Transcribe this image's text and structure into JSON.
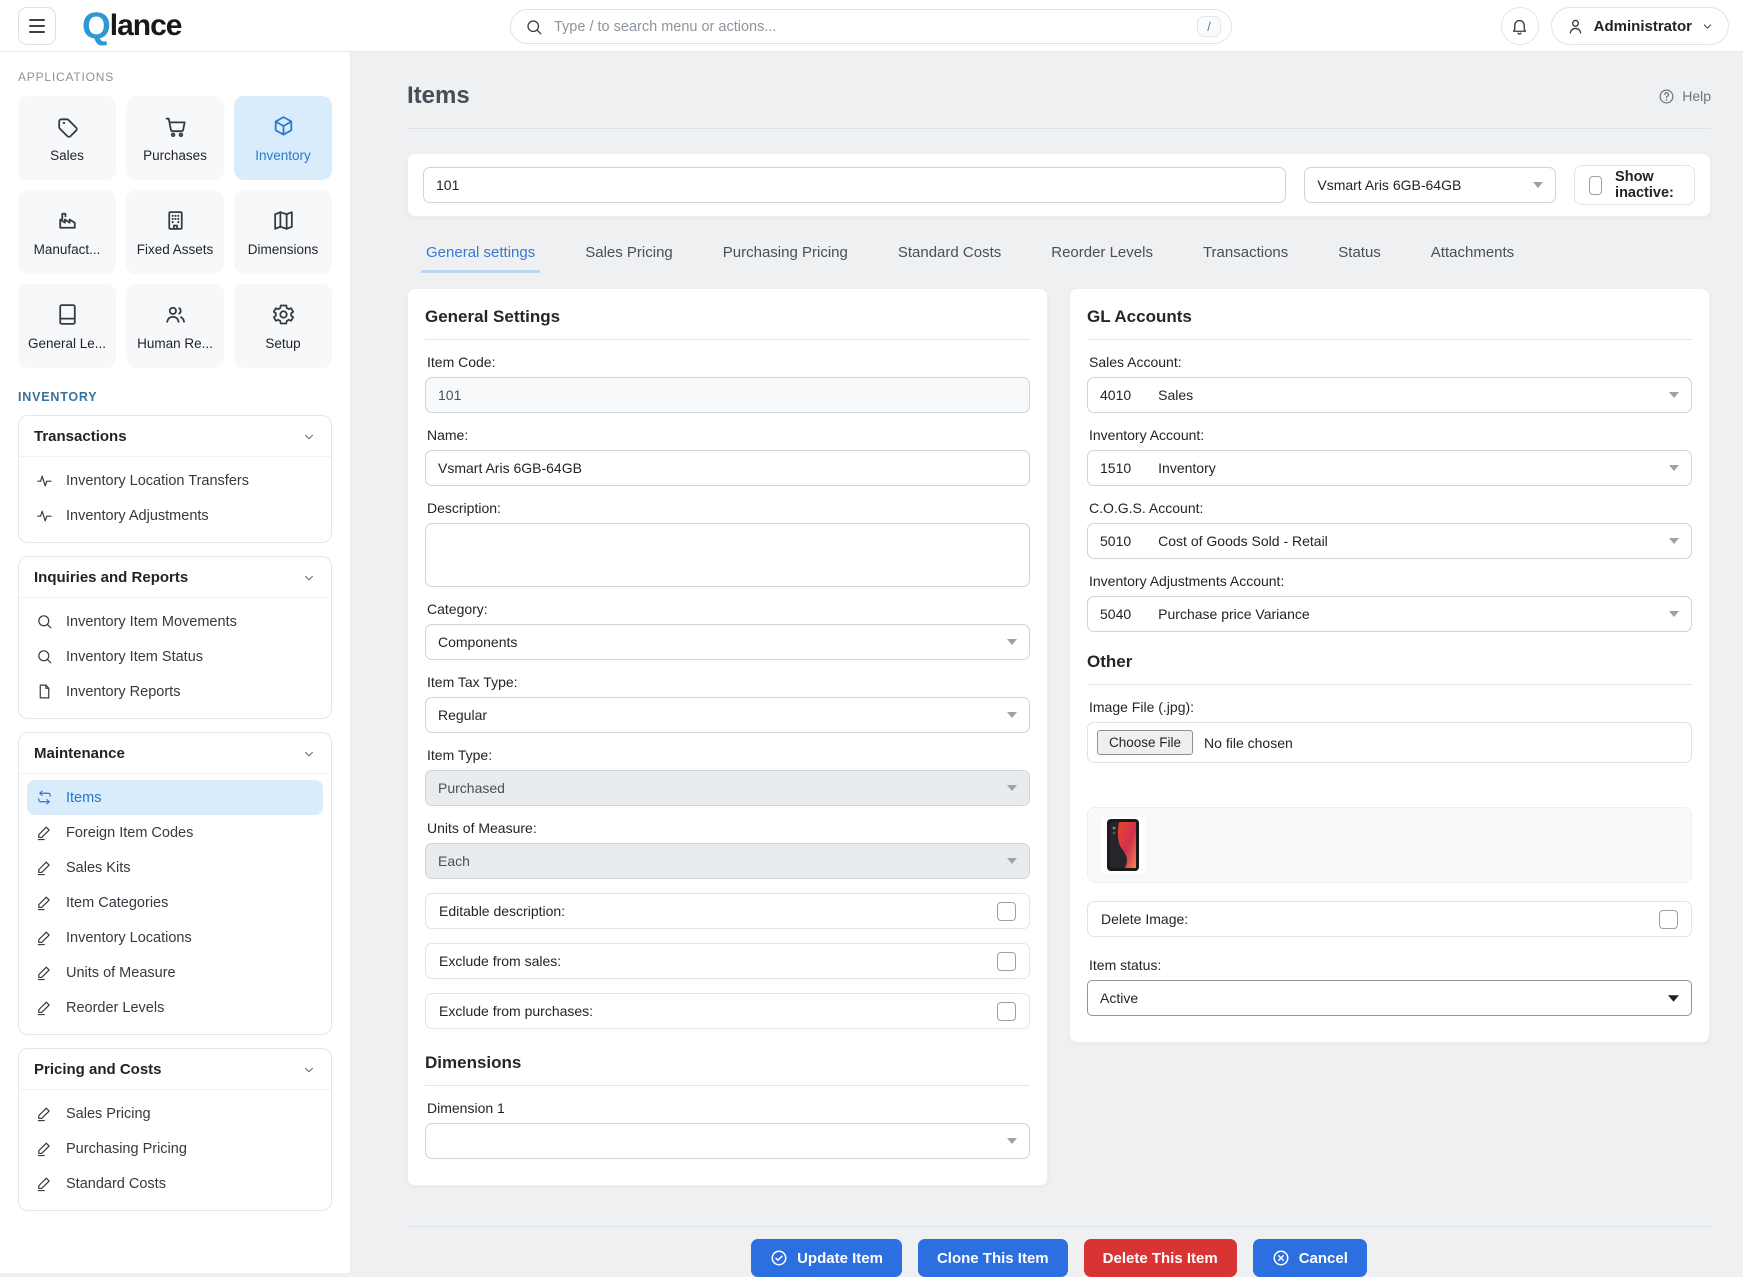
{
  "colors": {
    "accent_blue": "#2C6FE0",
    "danger_red": "#D93434",
    "active_item_bg": "#D9ECFC",
    "link_blue": "#2779C9",
    "brand_blue": "#2F97D4"
  },
  "topbar": {
    "logo_q": "Q",
    "logo_rest": "lance",
    "search_placeholder": "Type / to search menu or actions...",
    "search_shortcut": "/",
    "user_name": "Administrator"
  },
  "sidebar": {
    "applications_label": "APPLICATIONS",
    "apps": [
      {
        "label": "Sales",
        "icon": "tag-icon"
      },
      {
        "label": "Purchases",
        "icon": "cart-icon"
      },
      {
        "label": "Inventory",
        "icon": "cube-icon",
        "active": true
      },
      {
        "label": "Manufact...",
        "icon": "factory-icon"
      },
      {
        "label": "Fixed Assets",
        "icon": "building-icon"
      },
      {
        "label": "Dimensions",
        "icon": "map-icon"
      },
      {
        "label": "General Le...",
        "icon": "book-icon"
      },
      {
        "label": "Human Re...",
        "icon": "people-icon"
      },
      {
        "label": "Setup",
        "icon": "gear-icon"
      }
    ],
    "section_label": "INVENTORY",
    "groups": [
      {
        "title": "Transactions",
        "items": [
          {
            "label": "Inventory Location Transfers",
            "icon": "activity-icon"
          },
          {
            "label": "Inventory Adjustments",
            "icon": "activity-icon"
          }
        ]
      },
      {
        "title": "Inquiries and Reports",
        "items": [
          {
            "label": "Inventory Item Movements",
            "icon": "search-icon"
          },
          {
            "label": "Inventory Item Status",
            "icon": "search-icon"
          },
          {
            "label": "Inventory Reports",
            "icon": "document-icon"
          }
        ]
      },
      {
        "title": "Maintenance",
        "items": [
          {
            "label": "Items",
            "icon": "repeat-icon",
            "active": true
          },
          {
            "label": "Foreign Item Codes",
            "icon": "edit-icon"
          },
          {
            "label": "Sales Kits",
            "icon": "edit-icon"
          },
          {
            "label": "Item Categories",
            "icon": "edit-icon"
          },
          {
            "label": "Inventory Locations",
            "icon": "edit-icon"
          },
          {
            "label": "Units of Measure",
            "icon": "edit-icon"
          },
          {
            "label": "Reorder Levels",
            "icon": "edit-icon"
          }
        ]
      },
      {
        "title": "Pricing and Costs",
        "items": [
          {
            "label": "Sales Pricing",
            "icon": "edit-icon"
          },
          {
            "label": "Purchasing Pricing",
            "icon": "edit-icon"
          },
          {
            "label": "Standard Costs",
            "icon": "edit-icon"
          }
        ]
      }
    ]
  },
  "page": {
    "title": "Items",
    "help_label": "Help",
    "filter": {
      "item_code_value": "101",
      "item_select_value": "Vsmart Aris 6GB-64GB",
      "show_inactive_label": "Show inactive:"
    },
    "tabs": [
      {
        "label": "General settings",
        "active": true
      },
      {
        "label": "Sales Pricing"
      },
      {
        "label": "Purchasing Pricing"
      },
      {
        "label": "Standard Costs"
      },
      {
        "label": "Reorder Levels"
      },
      {
        "label": "Transactions"
      },
      {
        "label": "Status"
      },
      {
        "label": "Attachments"
      }
    ]
  },
  "general": {
    "heading": "General Settings",
    "item_code_label": "Item Code:",
    "item_code_value": "101",
    "name_label": "Name:",
    "name_value": "Vsmart Aris 6GB-64GB",
    "description_label": "Description:",
    "description_value": "",
    "category_label": "Category:",
    "category_value": "Components",
    "item_tax_type_label": "Item Tax Type:",
    "item_tax_type_value": "Regular",
    "item_type_label": "Item Type:",
    "item_type_value": "Purchased",
    "units_label": "Units of Measure:",
    "units_value": "Each",
    "checks": [
      {
        "label": "Editable description:",
        "checked": false
      },
      {
        "label": "Exclude from sales:",
        "checked": false
      },
      {
        "label": "Exclude from purchases:",
        "checked": false
      }
    ],
    "dimensions_heading": "Dimensions",
    "dimension1_label": "Dimension 1",
    "dimension1_value": ""
  },
  "gl": {
    "heading": "GL Accounts",
    "fields": [
      {
        "label": "Sales Account:",
        "code": "4010",
        "name": "Sales"
      },
      {
        "label": "Inventory Account:",
        "code": "1510",
        "name": "Inventory"
      },
      {
        "label": "C.O.G.S. Account:",
        "code": "5010",
        "name": "Cost of Goods Sold - Retail"
      },
      {
        "label": "Inventory Adjustments Account:",
        "code": "5040",
        "name": "Purchase price Variance"
      }
    ]
  },
  "other": {
    "heading": "Other",
    "image_file_label": "Image File (.jpg):",
    "choose_file_label": "Choose File",
    "no_file_text": "No file chosen",
    "delete_image_label": "Delete Image:",
    "delete_image_checked": false,
    "item_status_label": "Item status:",
    "item_status_value": "Active"
  },
  "actions": {
    "update": "Update Item",
    "clone": "Clone This Item",
    "delete": "Delete This Item",
    "cancel": "Cancel"
  }
}
